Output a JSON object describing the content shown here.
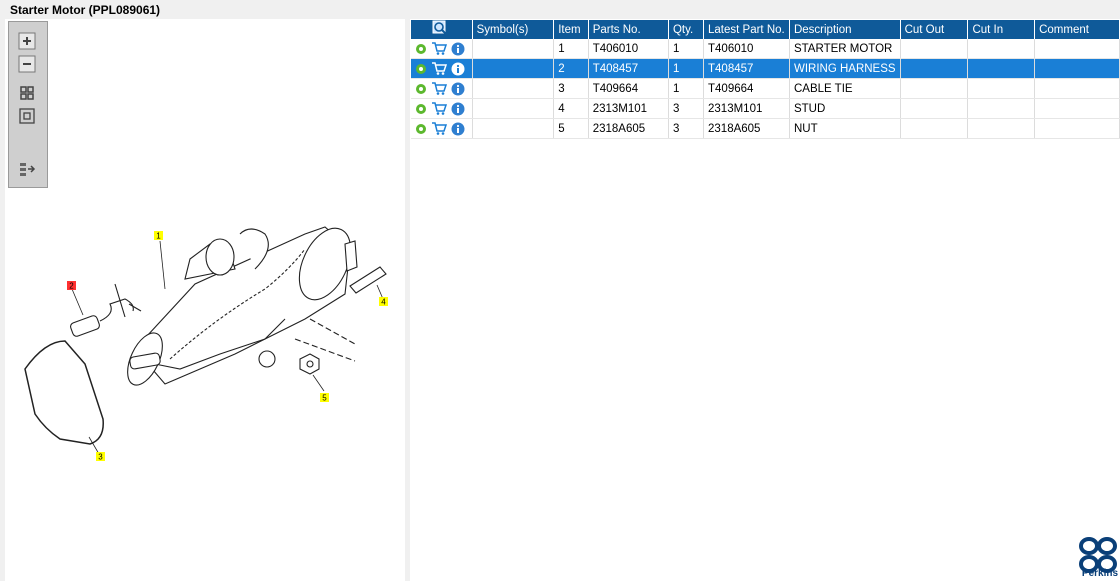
{
  "window": {
    "title": "Starter Motor (PPL089061)"
  },
  "drawing": {
    "callouts": [
      "1",
      "2",
      "3",
      "4",
      "5"
    ]
  },
  "table": {
    "headers": [
      "Symbol(s)",
      "Item",
      "Parts No.",
      "Qty.",
      "Latest Part No.",
      "Description",
      "Cut Out",
      "Cut In",
      "Comment"
    ],
    "rows": [
      {
        "item": "1",
        "parts_no": "T406010",
        "qty": "1",
        "latest": "T406010",
        "description": "STARTER MOTOR",
        "cut_out": "",
        "cut_in": "",
        "comment": ""
      },
      {
        "item": "2",
        "parts_no": "T408457",
        "qty": "1",
        "latest": "T408457",
        "description": "WIRING HARNESS",
        "cut_out": "",
        "cut_in": "",
        "comment": ""
      },
      {
        "item": "3",
        "parts_no": "T409664",
        "qty": "1",
        "latest": "T409664",
        "description": "CABLE TIE",
        "cut_out": "",
        "cut_in": "",
        "comment": ""
      },
      {
        "item": "4",
        "parts_no": "2313M101",
        "qty": "3",
        "latest": "2313M101",
        "description": "STUD",
        "cut_out": "",
        "cut_in": "",
        "comment": ""
      },
      {
        "item": "5",
        "parts_no": "2318A605",
        "qty": "3",
        "latest": "2318A605",
        "description": "NUT",
        "cut_out": "",
        "cut_in": "",
        "comment": ""
      }
    ],
    "selected_row": 1
  },
  "logo": {
    "text": "Perkins"
  },
  "colors": {
    "header": "#0f5a99",
    "selected": "#1a7fd6",
    "callout": "#ffff00",
    "callout_selected": "#ff3030"
  }
}
